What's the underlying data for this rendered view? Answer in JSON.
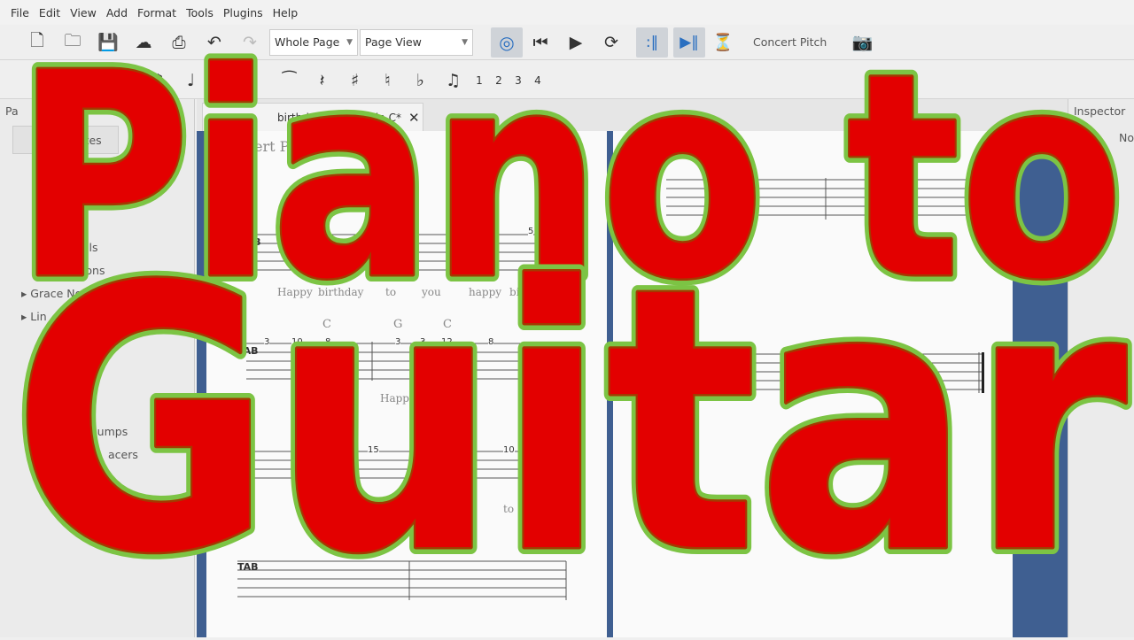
{
  "menu": [
    "File",
    "Edit",
    "View",
    "Add",
    "Format",
    "Tools",
    "Plugins",
    "Help"
  ],
  "toolbar": {
    "zoom": "Whole Page",
    "view_mode": "Page View",
    "concert_pitch": "Concert Pitch"
  },
  "note_toolbar": {
    "voices": [
      "1",
      "2",
      "3",
      "4"
    ]
  },
  "palette": {
    "title_fragment": "Pa",
    "button_fragment": "ettes",
    "items": [
      "tals",
      "tions",
      "Grace No",
      "Lin",
      "Jumps",
      "acers"
    ]
  },
  "tab": {
    "title_fragment": "birthday for Piano in C*",
    "close": "✕"
  },
  "inspector": {
    "title": "Inspector",
    "fragment": "No"
  },
  "score": {
    "title_fragment": "vert Pi",
    "lyrics1": [
      "Happy",
      "birthday",
      "to",
      "you",
      "happy",
      "birthd"
    ],
    "chords": [
      "C",
      "G",
      "C"
    ],
    "frets2": [
      "3",
      "10",
      "8",
      "3",
      "3",
      "12",
      "8"
    ],
    "fret1": "5",
    "lyrics2": "Happy",
    "line3": [
      "15",
      "10"
    ],
    "lyrics3": [
      "to"
    ],
    "tab_clef": "TAB"
  },
  "overlay": {
    "line1": "Piano to",
    "line2": "Guitar",
    "fill": "#e30000",
    "stroke": "#7cc444"
  }
}
